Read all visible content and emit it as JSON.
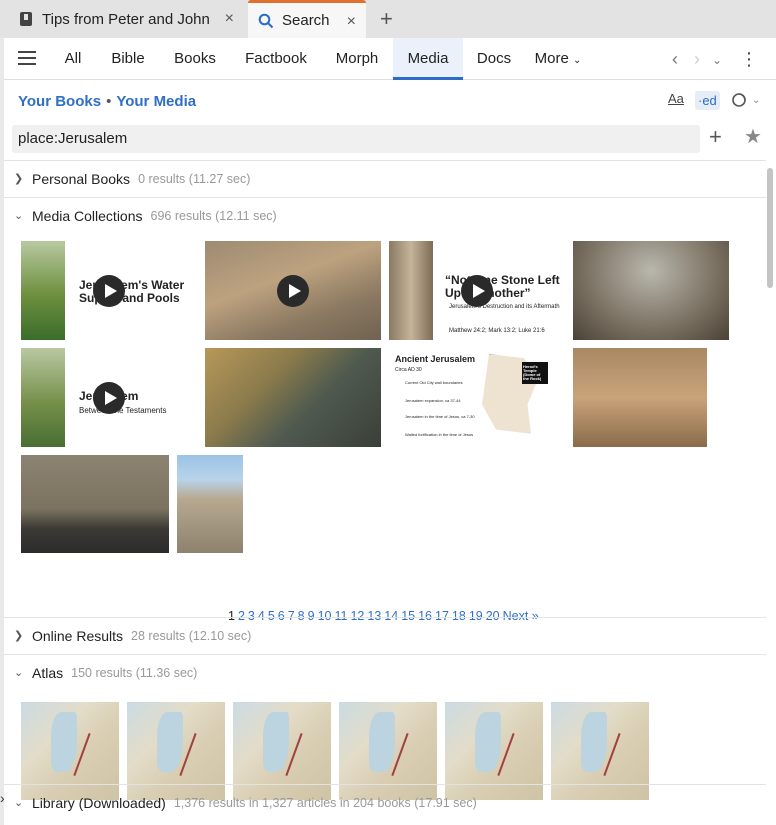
{
  "window_tabs": [
    {
      "label": "Tips from Peter and John",
      "close": "×"
    },
    {
      "label": "Search",
      "close": "×"
    }
  ],
  "new_tab": "+",
  "nav": {
    "tabs": [
      "All",
      "Bible",
      "Books",
      "Factbook",
      "Morph",
      "Media",
      "Docs",
      "More"
    ],
    "active": "Media"
  },
  "breadcrumb": {
    "your_books": "Your Books",
    "separator": "•",
    "your_media": "Your Media"
  },
  "tools": {
    "font": "Aa",
    "ed": "·ed"
  },
  "search": {
    "value": "place:Jerusalem"
  },
  "sections": {
    "personal_books": {
      "title": "Personal Books",
      "count": "0 results (11.27 sec)"
    },
    "media_collections": {
      "title": "Media Collections",
      "count": "696 results (12.11 sec)"
    },
    "online_results": {
      "title": "Online Results",
      "count": "28 results (12.10 sec)"
    },
    "atlas": {
      "title": "Atlas",
      "count": "150 results (11.36 sec)"
    },
    "library": {
      "title": "Library (Downloaded)",
      "count": "1,376 results in 1,327 articles in 204 books (17.91 sec)"
    }
  },
  "media_items": [
    {
      "title": "Jerusalem's Water Supply and Pools",
      "kind": "video"
    },
    {
      "title": "",
      "kind": "video"
    },
    {
      "title": "“Not One Stone Left Upon Another”",
      "subtitle": "Jerusalem's Destruction and its Aftermath",
      "ref": "Matthew 24:2; Mark 13:2; Luke 21:6",
      "kind": "video"
    },
    {
      "title": "",
      "kind": "image"
    },
    {
      "title": "Jerusalem",
      "subtitle": "Between the Testaments",
      "kind": "video"
    },
    {
      "title": "",
      "kind": "image"
    },
    {
      "title": "Ancient Jerusalem",
      "subtitle": "Circa AD 30",
      "legend": [
        "Current Old City wall boundaries",
        "Jerusalem expansion, ca 37-44",
        "Jerusalem in the time of Jesus, ca 7-30",
        "Walled fortification in the time of Jesus"
      ],
      "label": "Herod's Temple (Dome of the Rock)",
      "kind": "image"
    },
    {
      "title": "",
      "kind": "image"
    },
    {
      "title": "",
      "kind": "image"
    },
    {
      "title": "",
      "kind": "image"
    }
  ],
  "pager": {
    "pages": [
      "1",
      "2",
      "3",
      "4",
      "5",
      "6",
      "7",
      "8",
      "9",
      "10",
      "11",
      "12",
      "13",
      "14",
      "15",
      "16",
      "17",
      "18",
      "19",
      "20"
    ],
    "current": "1",
    "next": "Next »"
  },
  "atlas_maps": 6,
  "colors": {
    "accent": "#2b6cc4",
    "active_tab_border": "#e07030",
    "link": "#2f6fc6"
  }
}
